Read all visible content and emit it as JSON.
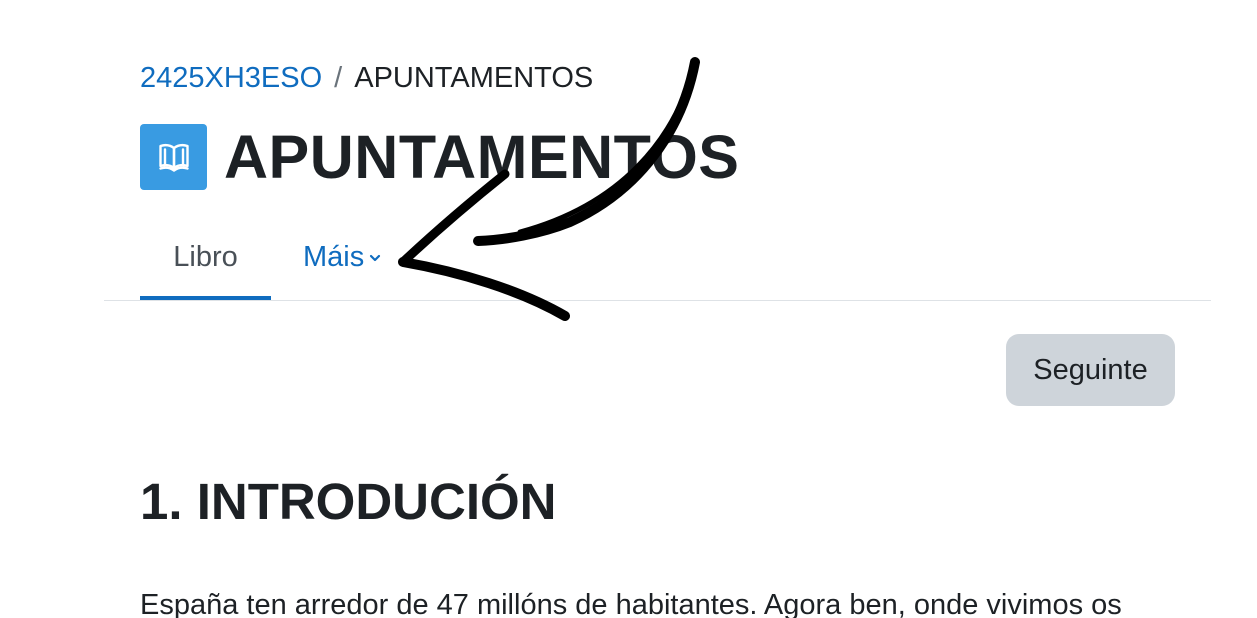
{
  "breadcrumb": {
    "course": "2425XH3ESO",
    "separator": "/",
    "current": "APUNTAMENTOS"
  },
  "header": {
    "icon": "book-icon",
    "icon_color": "#399be2",
    "title": "APUNTAMENTOS"
  },
  "nav": {
    "tabs": [
      {
        "label": "Libro",
        "active": true
      },
      {
        "label": "Máis",
        "active": false,
        "has_dropdown": true
      }
    ]
  },
  "pager": {
    "next_label": "Seguinte"
  },
  "content": {
    "section_title": "1. INTRODUCIÓN",
    "paragraph": "España ten arredor de 47 millóns de habitantes. Agora ben, onde vivimos os"
  },
  "colors": {
    "link": "#0f6cbf",
    "active_tab_underline": "#0f6cbf",
    "button_bg": "#ced4da",
    "text": "#1d2125",
    "annotation": "#000000"
  }
}
